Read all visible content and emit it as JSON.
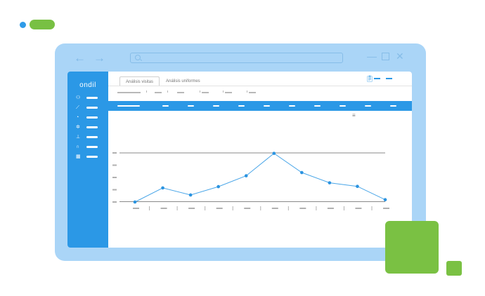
{
  "colors": {
    "accent": "#2b98e6",
    "window_frame": "#97ccf5",
    "decor_green": "#7ac143",
    "decor_pill": "#78c043",
    "line": "#4aa6e8",
    "point": "#2a93e0"
  },
  "window": {
    "nav_back_icon": "arrow-left-icon",
    "nav_forward_icon": "arrow-right-icon",
    "address_icon": "search-icon",
    "controls": [
      "minimize-icon",
      "maximize-icon",
      "close-icon"
    ]
  },
  "app": {
    "logo": "ondil",
    "sidebar": {
      "items": [
        {
          "icon": "users-icon",
          "glyph": "⚇"
        },
        {
          "icon": "trend-icon",
          "glyph": "⟋"
        },
        {
          "icon": "gauge-icon",
          "glyph": "◔"
        },
        {
          "icon": "gear-icon",
          "glyph": "✲"
        },
        {
          "icon": "bar-chart-icon",
          "glyph": "⊥"
        },
        {
          "icon": "headset-icon",
          "glyph": "∩"
        },
        {
          "icon": "calendar-icon",
          "glyph": "▦"
        }
      ]
    },
    "tabs": [
      {
        "label": "Análisis visitas"
      },
      {
        "label": "Análisis uniformes"
      }
    ],
    "utility_icon": "clipboard-icon",
    "chart_menu_glyph": "≡"
  },
  "chart_data": {
    "type": "line",
    "title": "",
    "xlabel": "",
    "ylabel": "",
    "x": [
      1,
      2,
      3,
      4,
      5,
      6,
      7,
      8,
      9,
      10
    ],
    "series": [
      {
        "values": [
          0,
          1.1,
          0.55,
          1.2,
          2.05,
          3.8,
          2.3,
          1.5,
          1.22,
          0.18
        ]
      }
    ],
    "ylim": [
      0,
      4
    ],
    "grid": false,
    "tick_labels_redacted": true
  }
}
